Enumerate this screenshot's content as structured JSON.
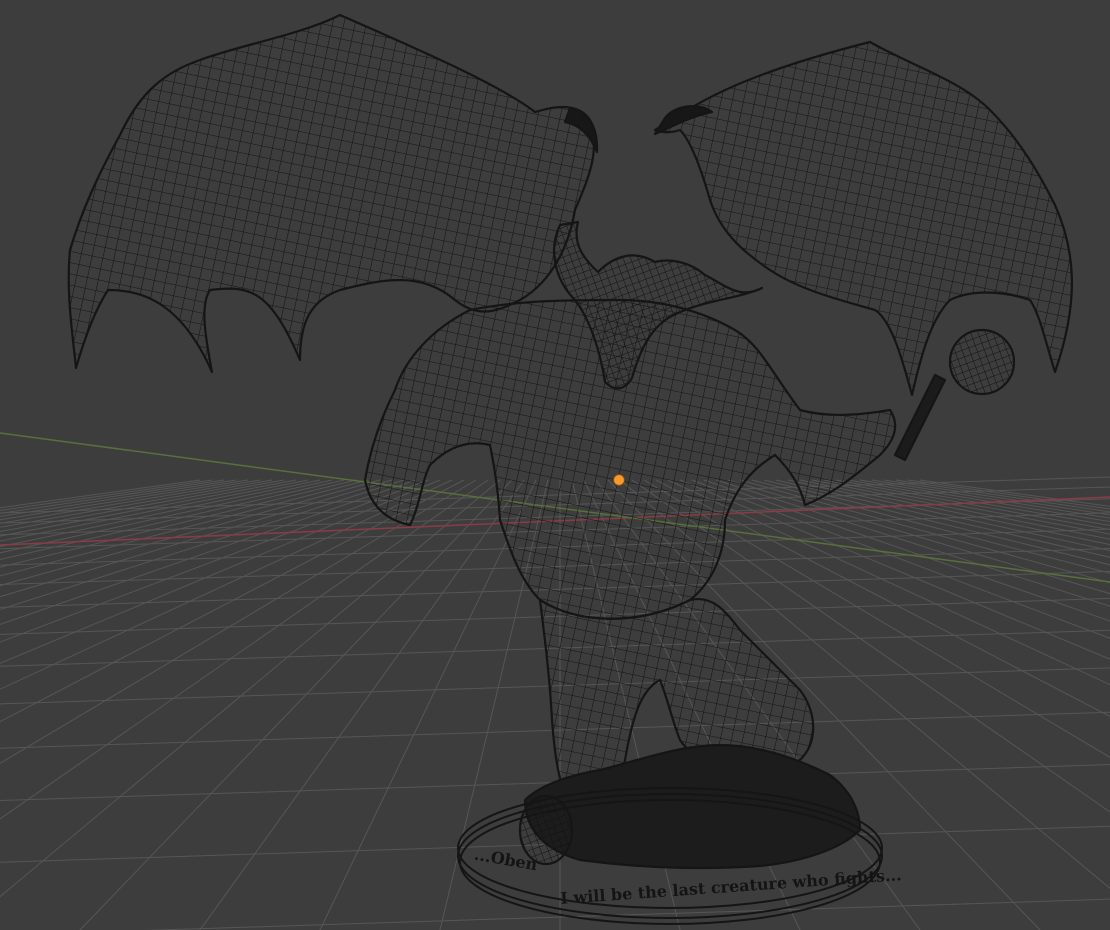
{
  "viewport": {
    "background": "#3d3d3d",
    "grid_color": "#565656",
    "x_axis_color": "#8a3c46",
    "y_axis_color": "#56713a",
    "wire_color": "#161616",
    "origin_color": "#f59a2e",
    "shading": "wireframe"
  },
  "model": {
    "subject": "winged demon miniature on round base",
    "base_text_left": "...Oben",
    "base_text_right": "I will be the last creature who fights..."
  }
}
